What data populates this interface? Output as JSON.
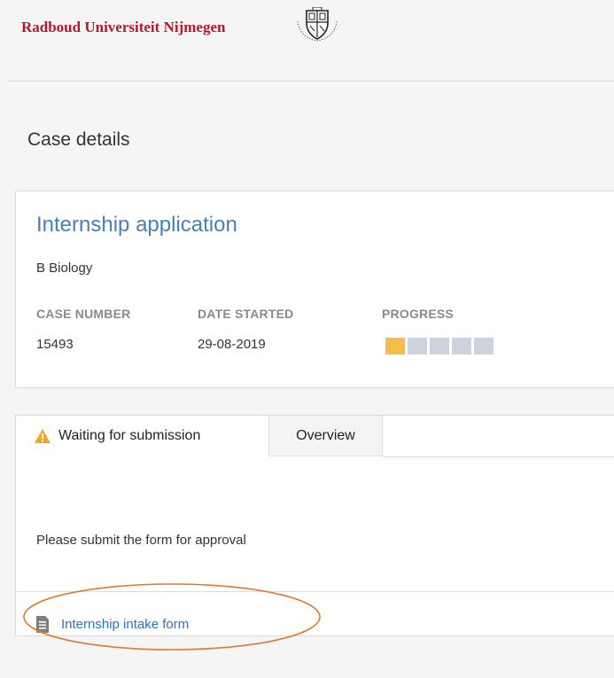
{
  "header": {
    "university_name": "Radboud Universiteit Nijmegen",
    "logo_icon": "university-seal-icon"
  },
  "page": {
    "title": "Case details"
  },
  "case": {
    "title": "Internship application",
    "department": "B Biology",
    "labels": {
      "case_number": "CASE NUMBER",
      "date_started": "DATE STARTED",
      "progress": "PROGRESS"
    },
    "case_number": "15493",
    "date_started": "29-08-2019",
    "progress": {
      "completed": 1,
      "total": 5
    }
  },
  "tabs": [
    {
      "label": "Waiting for submission",
      "icon": "warning-icon",
      "active": true
    },
    {
      "label": "Overview",
      "active": false
    }
  ],
  "task": {
    "instruction": "Please submit the form for approval",
    "form_link_label": "Internship intake form",
    "form_link_icon": "document-icon"
  },
  "colors": {
    "brand_red": "#b3192b",
    "link_blue": "#2c72c7",
    "title_blue": "#4a7ebb",
    "progress_done": "#f5bd4f",
    "progress_todo": "#cdd3dc",
    "warning": "#f5a623",
    "annotation_orange": "#e07a2e"
  }
}
